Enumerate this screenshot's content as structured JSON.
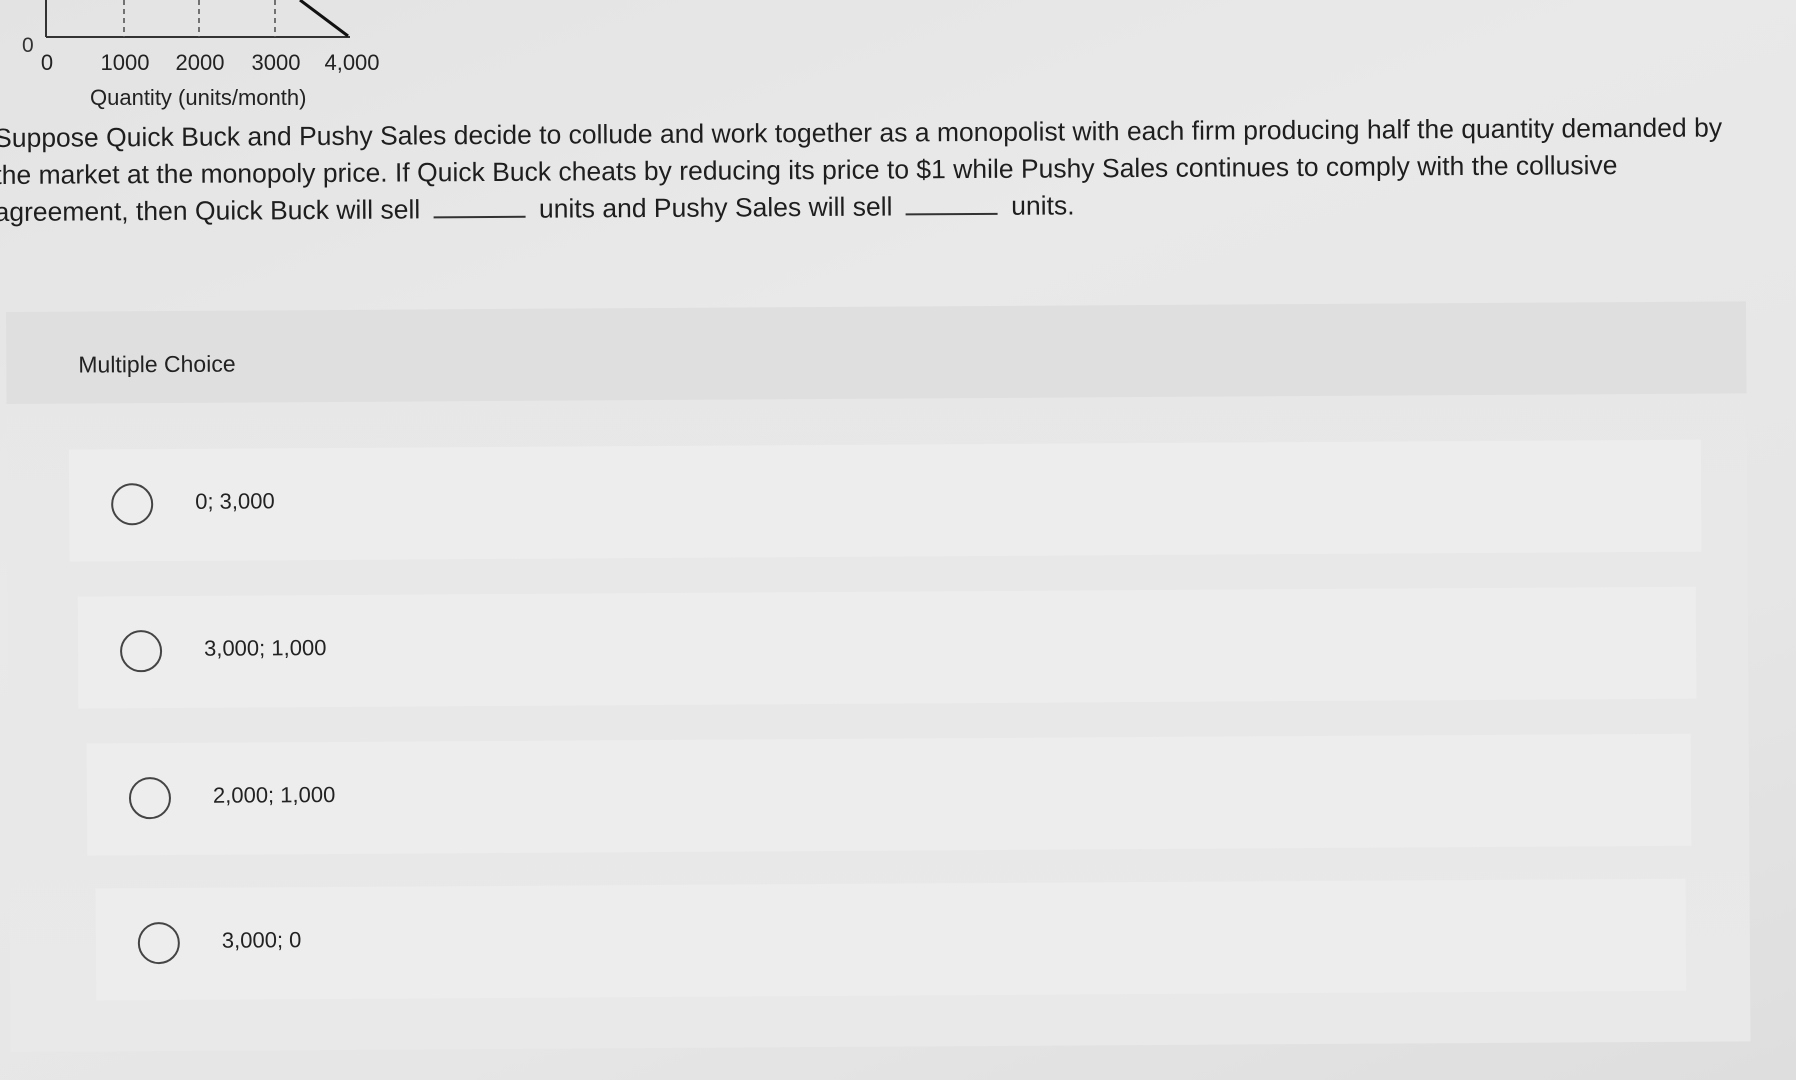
{
  "chart_fragment": {
    "y_origin_label": "0",
    "x_ticks": [
      "0",
      "1000",
      "2000",
      "3000",
      "4,000"
    ],
    "x_axis_label": "Quantity (units/month)"
  },
  "question": {
    "text_1": "Suppose Quick Buck and Pushy Sales decide to collude and work together as a monopolist with each firm producing half the quantity demanded by the market at the monopoly price. If Quick Buck cheats by reducing its price to $1 while Pushy Sales continues to comply with the collusive agreement, then Quick Buck will sell",
    "text_2": "units and Pushy Sales will sell",
    "text_3": "units."
  },
  "multiple_choice": {
    "title": "Multiple Choice",
    "options": [
      {
        "label": "0; 3,000"
      },
      {
        "label": "3,000; 1,000"
      },
      {
        "label": "2,000; 1,000"
      },
      {
        "label": "3,000; 0"
      }
    ]
  }
}
